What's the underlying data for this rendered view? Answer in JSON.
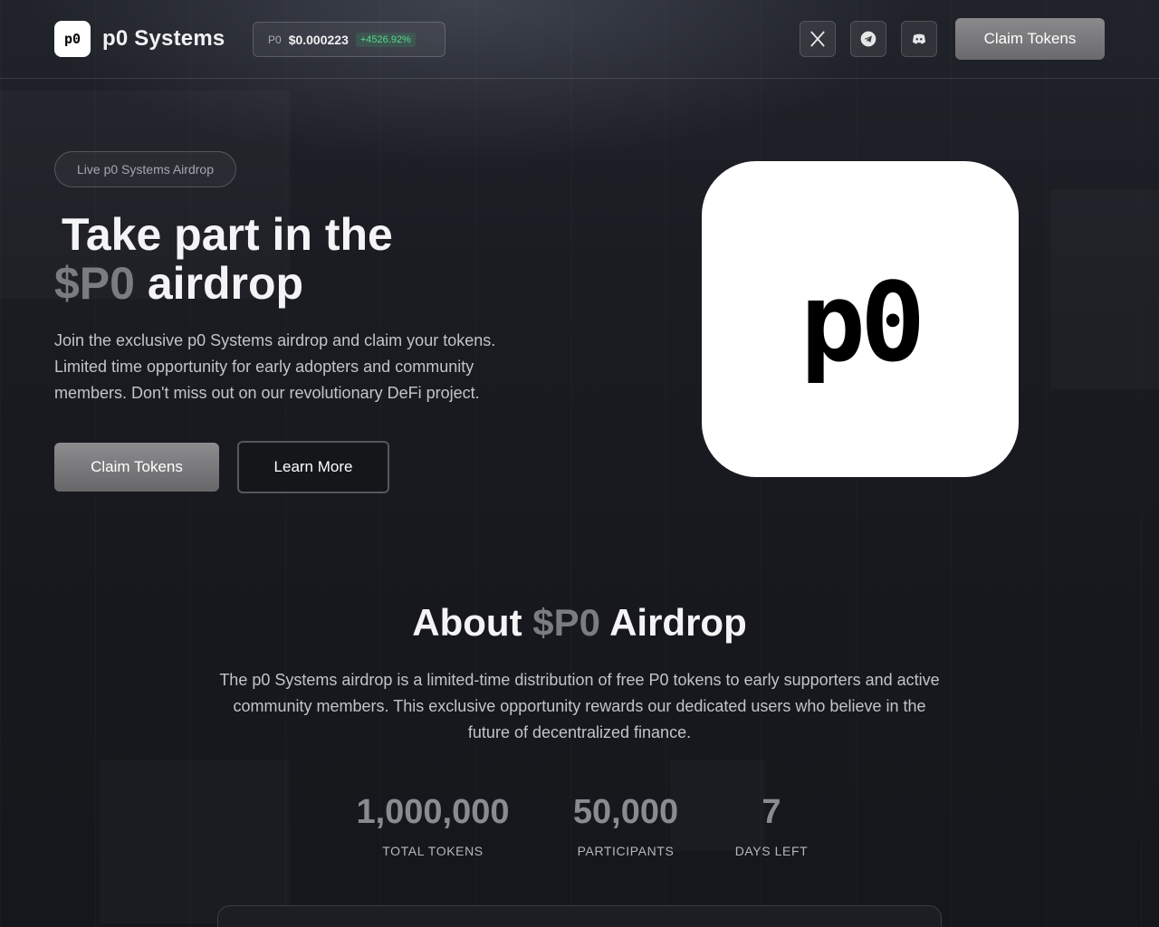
{
  "header": {
    "logo_text": "p0",
    "brand": "p0 Systems",
    "ticker": {
      "symbol": "P0",
      "price": "$0.000223",
      "change": "+4526.92%"
    },
    "social": [
      {
        "name": "x-icon"
      },
      {
        "name": "telegram-icon"
      },
      {
        "name": "discord-icon"
      }
    ],
    "claim_label": "Claim Tokens"
  },
  "hero": {
    "pill": "Live p0 Systems Airdrop",
    "title_line1": "Take part in the",
    "title_accent": "$P0",
    "title_rest": " airdrop",
    "description": "Join the exclusive p0 Systems airdrop and claim your tokens. Limited time opportunity for early adopters and community members. Don't miss out on our revolutionary DeFi project.",
    "claim_label": "Claim Tokens",
    "learn_label": "Learn More",
    "logo_text": "p0"
  },
  "about": {
    "title_prefix": "About ",
    "title_accent": "$P0",
    "title_suffix": " Airdrop",
    "description": "The p0 Systems airdrop is a limited-time distribution of free P0 tokens to early supporters and active community members. This exclusive opportunity rewards our dedicated users who believe in the future of decentralized finance.",
    "stats": [
      {
        "value": "1,000,000",
        "label": "TOTAL TOKENS"
      },
      {
        "value": "50,000",
        "label": "PARTICIPANTS"
      },
      {
        "value": "7",
        "label": "DAYS LEFT"
      }
    ]
  },
  "colors": {
    "background": "#15171c",
    "accent_gray": "#7b7c80",
    "positive": "#55d98a"
  }
}
